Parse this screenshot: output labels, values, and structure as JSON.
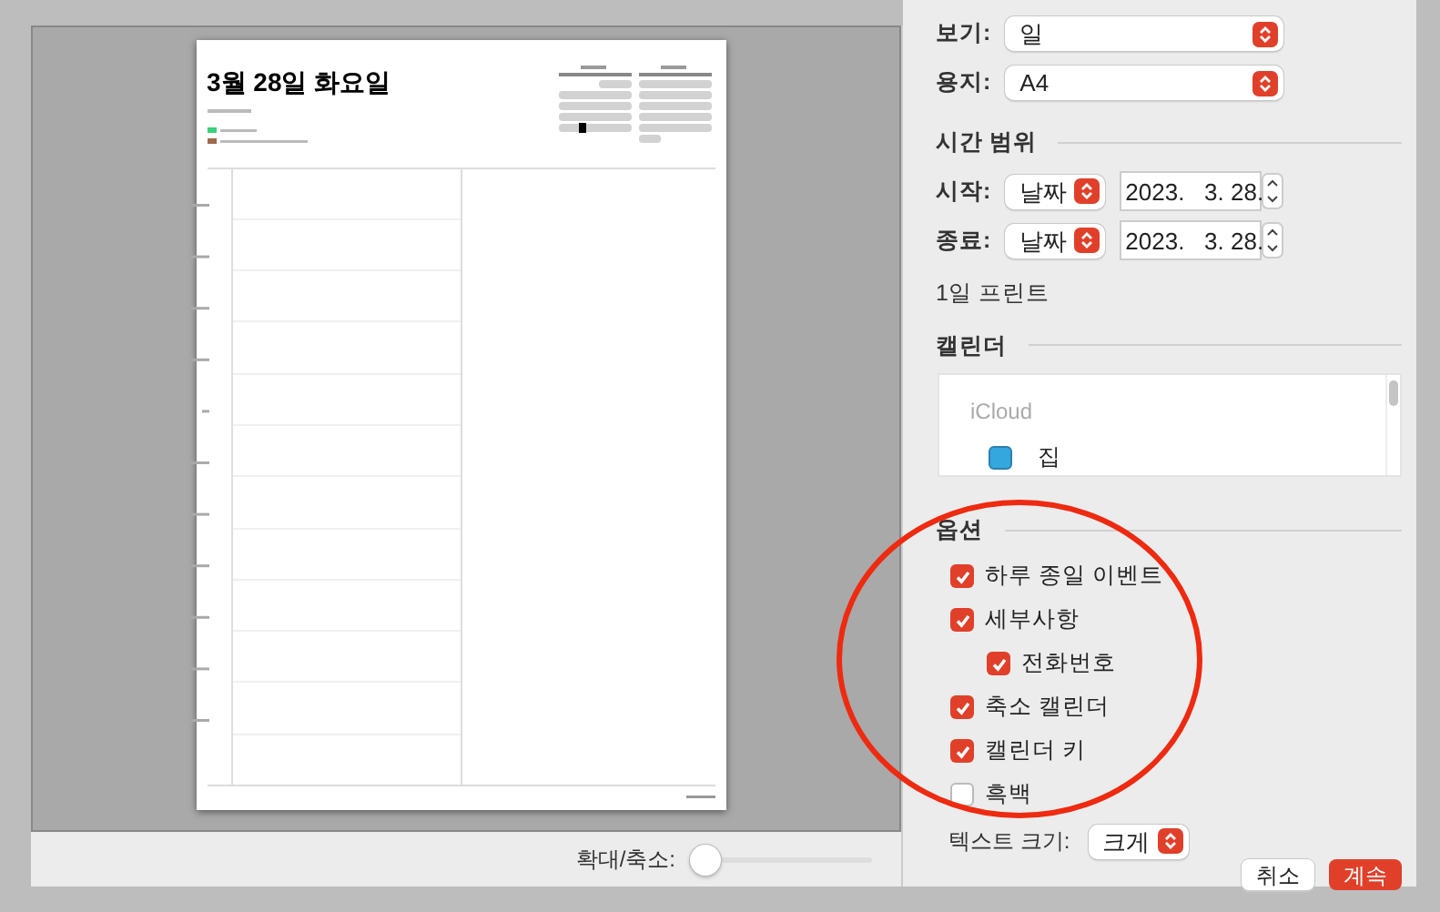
{
  "preview": {
    "title": "3월 28일 화요일"
  },
  "zoom": {
    "label": "확대/축소:",
    "level": 0
  },
  "settings": {
    "view": {
      "label": "보기:",
      "value": "일"
    },
    "paper": {
      "label": "용지:",
      "value": "A4"
    },
    "time_range": {
      "heading": "시간 범위",
      "rows": [
        {
          "label": "시작:",
          "unit": "날짜",
          "date": "2023.   3. 28."
        },
        {
          "label": "종료:",
          "unit": "날짜",
          "date": "2023.   3. 28."
        }
      ],
      "summary": "1일 프린트"
    },
    "calendars": {
      "heading": "캘린더",
      "group": "iCloud",
      "items": [
        {
          "name": "집",
          "color": "#34a7de"
        }
      ]
    },
    "options": {
      "heading": "옵션",
      "items": [
        {
          "label": "하루 종일 이벤트",
          "checked": true
        },
        {
          "label": "세부사항",
          "checked": true,
          "children": [
            {
              "label": "전화번호",
              "checked": true
            }
          ]
        },
        {
          "label": "축소 캘린더",
          "checked": true
        },
        {
          "label": "캘린더 키",
          "checked": true
        },
        {
          "label": "흑백",
          "checked": false
        }
      ]
    },
    "text_size": {
      "label": "텍스트 크기:",
      "value": "크게"
    }
  },
  "buttons": [
    {
      "label": "취소",
      "kind": "secondary"
    },
    {
      "label": "계속",
      "kind": "primary"
    }
  ]
}
